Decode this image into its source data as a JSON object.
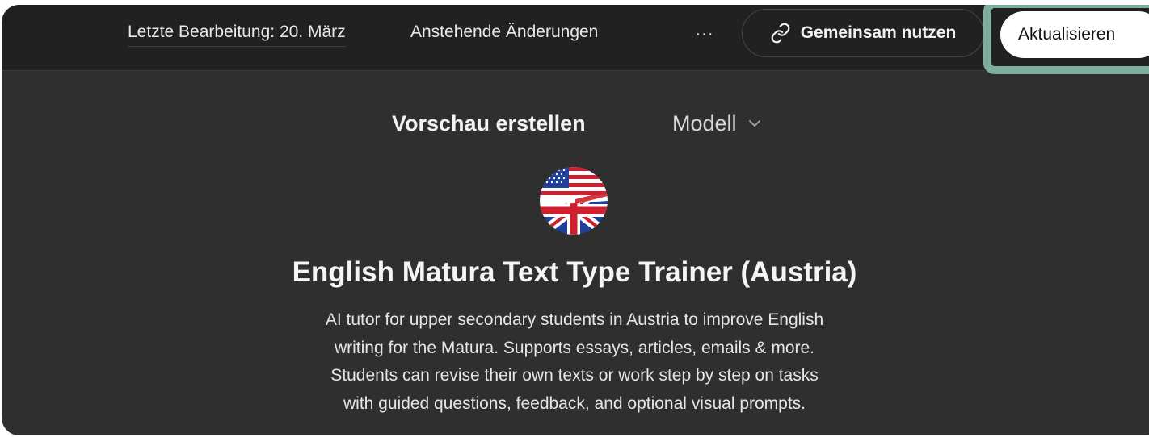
{
  "header": {
    "last_edit": "Letzte Bearbeitung: 20. März",
    "pending_changes": "Anstehende Änderungen",
    "more_label": "···",
    "share_label": "Gemeinsam nutzen",
    "share_icon": "link-icon",
    "update_label": "Aktualisieren",
    "highlight_color": "#7eae9d"
  },
  "toolbar": {
    "preview_tab": "Vorschau erstellen",
    "model_label": "Modell",
    "model_icon": "chevron-down-icon"
  },
  "gpt": {
    "avatar_icon": "us-uk-flag-avatar",
    "title": "English Matura Text Type Trainer (Austria)",
    "description_lines": [
      "AI tutor for upper secondary students in Austria to improve English",
      "writing for the Matura. Supports essays, articles, emails & more.",
      "Students can revise their own texts or work step by step on tasks",
      "with guided questions, feedback, and optional visual prompts."
    ]
  }
}
